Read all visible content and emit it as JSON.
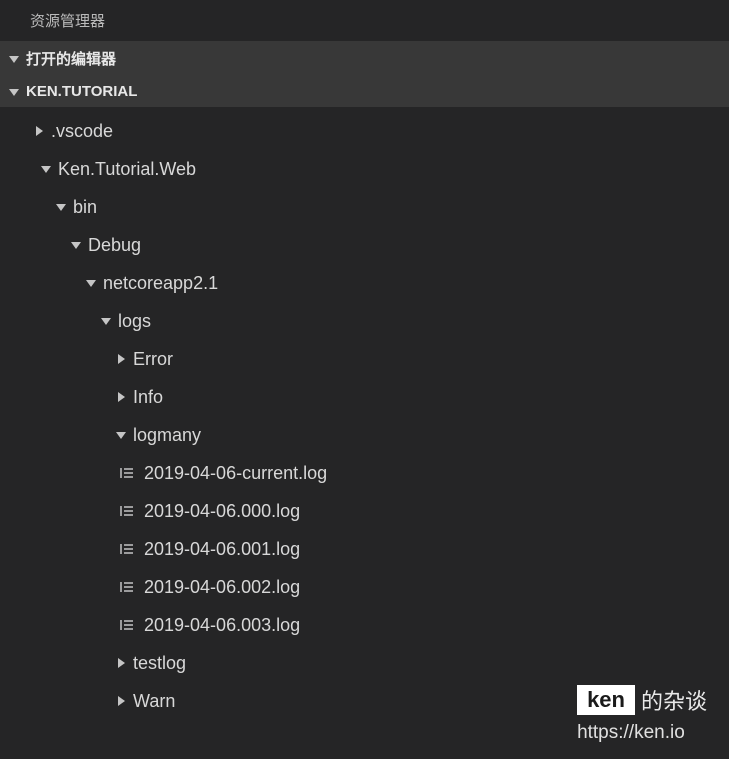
{
  "explorer": {
    "title": "资源管理器"
  },
  "sections": {
    "openEditors": "打开的编辑器",
    "project": "KEN.TUTORIAL"
  },
  "tree": {
    "vscode": ".vscode",
    "kenWeb": "Ken.Tutorial.Web",
    "bin": "bin",
    "debug": "Debug",
    "netcoreapp": "netcoreapp2.1",
    "logs": "logs",
    "error": "Error",
    "info": "Info",
    "logmany": "logmany",
    "files": [
      "2019-04-06-current.log",
      "2019-04-06.000.log",
      "2019-04-06.001.log",
      "2019-04-06.002.log",
      "2019-04-06.003.log"
    ],
    "testlog": "testlog",
    "warn": "Warn"
  },
  "watermark": {
    "badge": "ken",
    "text": "的杂谈",
    "url": "https://ken.io"
  }
}
